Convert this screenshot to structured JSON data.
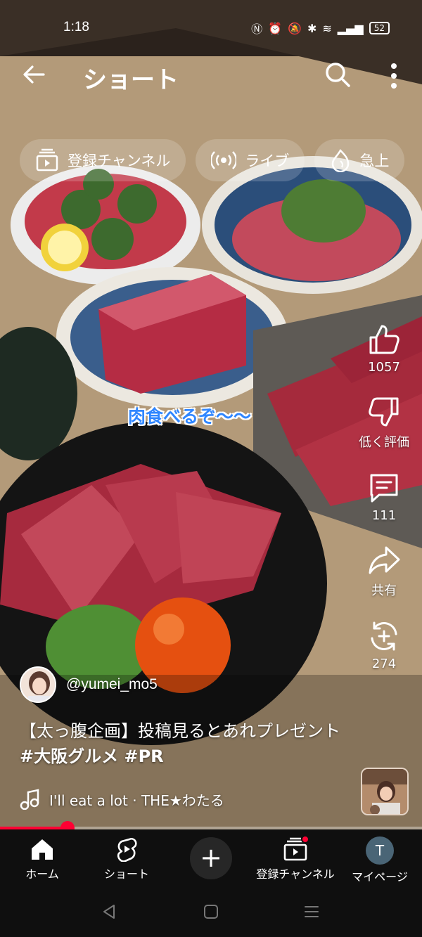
{
  "status_bar": {
    "time": "1:18",
    "battery": "52"
  },
  "top_bar": {
    "title": "ショート"
  },
  "chips": [
    {
      "label": "登録チャンネル",
      "icon": "subscriptions-icon"
    },
    {
      "label": "ライブ",
      "icon": "live-icon"
    },
    {
      "label": "急上",
      "icon": "trending-icon"
    }
  ],
  "video": {
    "caption": "肉食べるぞ〜〜"
  },
  "actions": {
    "like_count": "1057",
    "dislike_label": "低く評価",
    "comment_count": "111",
    "share_label": "共有",
    "remix_count": "274"
  },
  "channel": {
    "handle": "@yumei_mo5"
  },
  "description": {
    "text": "【太っ腹企画】投稿見るとあれプレゼント",
    "tags": "#大阪グルメ #PR"
  },
  "music": {
    "track": "I'll eat a lot · THE★わたる"
  },
  "progress": {
    "fraction": 0.16
  },
  "bottom_nav": {
    "home": "ホーム",
    "shorts": "ショート",
    "subscriptions": "登録チャンネル",
    "mypage": "マイページ",
    "avatar_letter": "T"
  },
  "colors": {
    "accent": "#ff0033",
    "caption": "#2f86ff",
    "nav_bg": "#0f0f0f"
  }
}
